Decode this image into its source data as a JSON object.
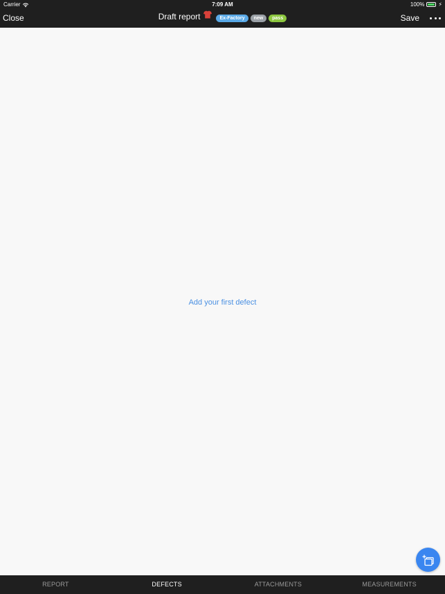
{
  "status_bar": {
    "carrier": "Carrier",
    "time": "7:09 AM",
    "battery": "100%"
  },
  "nav": {
    "close_label": "Close",
    "title": "Draft report",
    "tags": [
      {
        "label": "Ex-Factory",
        "color": "#5aa9e6"
      },
      {
        "label": "new",
        "color": "#9aa0a6"
      },
      {
        "label": "pass",
        "color": "#8cc63f"
      }
    ],
    "save_label": "Save",
    "shirt_icon": "shirt-icon",
    "shirt_color": "#d9413a"
  },
  "main": {
    "empty_prompt": "Add your first defect"
  },
  "fab": {
    "icon": "add-photo-icon",
    "color": "#3a86f0"
  },
  "tabs": [
    {
      "label": "REPORT",
      "active": false
    },
    {
      "label": "DEFECTS",
      "active": true
    },
    {
      "label": "ATTACHMENTS",
      "active": false
    },
    {
      "label": "MEASUREMENTS",
      "active": false
    }
  ]
}
